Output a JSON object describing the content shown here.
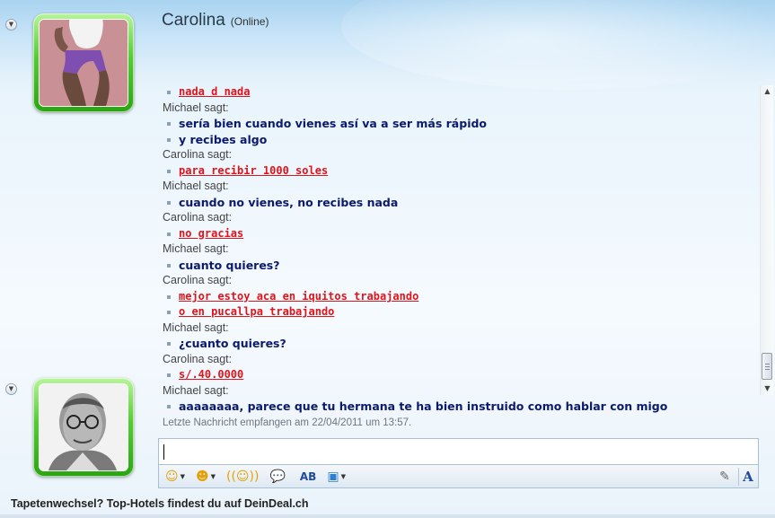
{
  "header": {
    "contact_name": "Carolina",
    "contact_status": "(Online)"
  },
  "conversation": [
    {
      "sender": "",
      "who": "carolina",
      "lines": [
        "nada d nada"
      ]
    },
    {
      "sender": "Michael sagt:",
      "who": "michael",
      "lines": [
        "sería bien cuando vienes así va a ser más rápido",
        "y recibes algo"
      ]
    },
    {
      "sender": "Carolina sagt:",
      "who": "carolina",
      "lines": [
        "para recibir 1000 soles"
      ]
    },
    {
      "sender": "Michael sagt:",
      "who": "michael",
      "lines": [
        "cuando no vienes, no recibes nada"
      ]
    },
    {
      "sender": "Carolina sagt:",
      "who": "carolina",
      "lines": [
        "no gracias"
      ]
    },
    {
      "sender": "Michael sagt:",
      "who": "michael",
      "lines": [
        "cuanto quieres?"
      ]
    },
    {
      "sender": "Carolina sagt:",
      "who": "carolina",
      "lines": [
        "mejor estoy aca en iquitos trabajando",
        "o en pucallpa trabajando"
      ]
    },
    {
      "sender": "Michael sagt:",
      "who": "michael",
      "lines": [
        "¿cuanto quieres?"
      ]
    },
    {
      "sender": "Carolina sagt:",
      "who": "carolina",
      "lines": [
        "s/.40.0000"
      ]
    },
    {
      "sender": "Michael sagt:",
      "who": "michael",
      "lines": [
        "aaaaaaaa, parece que tu hermana te ha bien instruido como hablar con migo"
      ]
    }
  ],
  "last_received": "Letzte Nachricht empfangen am 22/04/2011 um 13:57.",
  "input": {
    "value": ""
  },
  "toolbar": {
    "emoticon_icon": "smiley-icon",
    "wink_icon": "wink-icon",
    "nudge_icon": "nudge-icon",
    "voice_clip_icon": "voice-clip-icon",
    "spellcheck_icon": "spellcheck-icon",
    "background_icon": "background-image-icon",
    "handwriting_icon": "pen-icon",
    "font_label": "A"
  },
  "ad_text": "Tapetenwechsel? Top-Hotels findest du auf DeinDeal.ch",
  "colors": {
    "michael_text": "#0b1a6e",
    "carolina_text": "#e0141b",
    "avatar_frame_green": "#4fcf2c"
  }
}
